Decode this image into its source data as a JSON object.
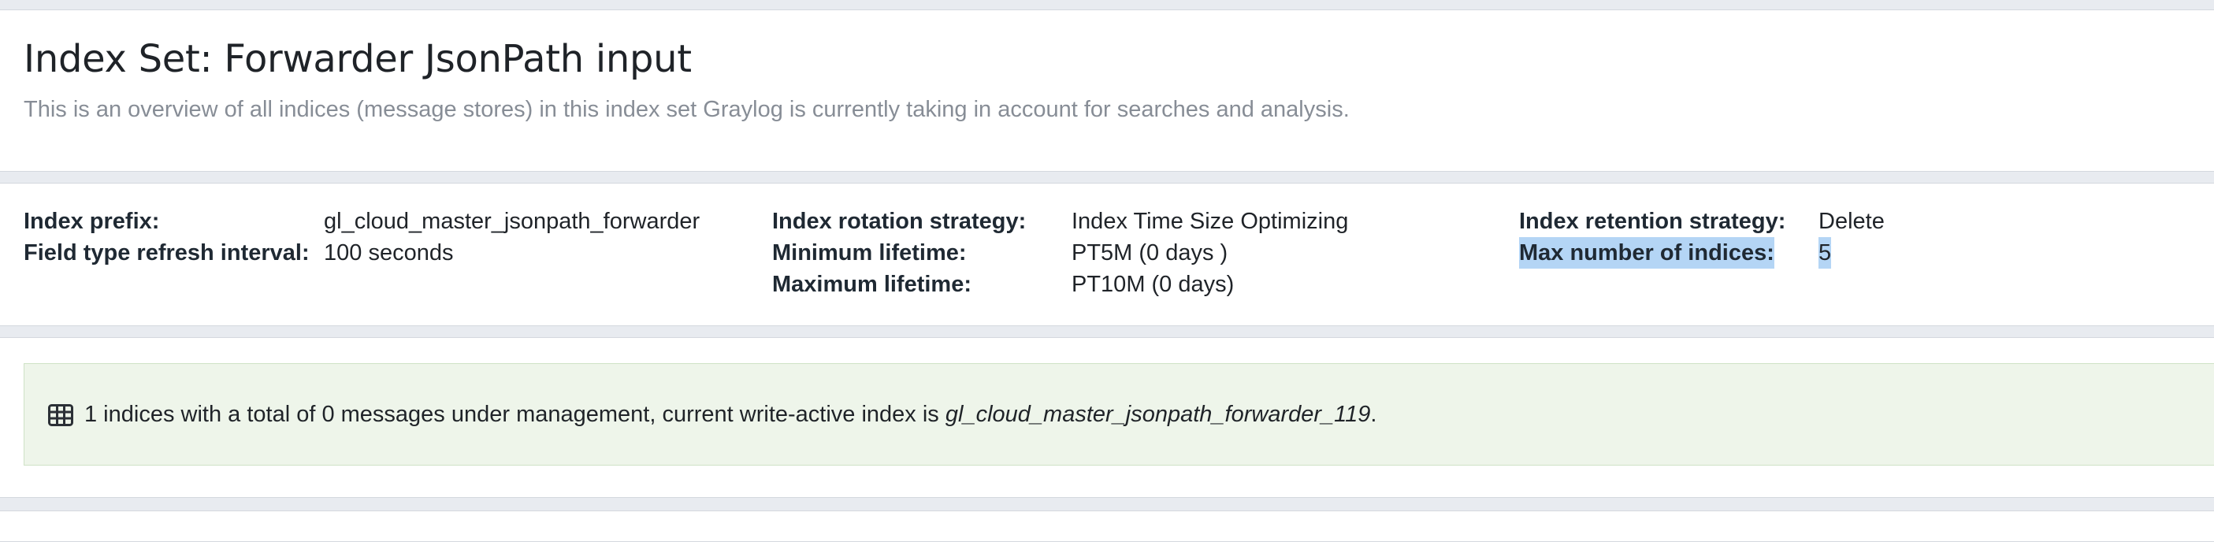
{
  "header": {
    "title": "Index Set: Forwarder JsonPath input",
    "description": "This is an overview of all indices (message stores) in this index set Graylog is currently taking in account for searches and analysis."
  },
  "config": {
    "index_prefix": {
      "label": "Index prefix:",
      "value": "gl_cloud_master_jsonpath_forwarder"
    },
    "field_type_refresh": {
      "label": "Field type refresh interval:",
      "value": "100 seconds"
    },
    "rotation_strategy": {
      "label": "Index rotation strategy:",
      "value": "Index Time Size Optimizing"
    },
    "min_lifetime": {
      "label": "Minimum lifetime:",
      "value": "PT5M (0 days )"
    },
    "max_lifetime": {
      "label": "Maximum lifetime:",
      "value": "PT10M (0 days)"
    },
    "retention_strategy": {
      "label": "Index retention strategy:",
      "value": "Delete"
    },
    "max_indices": {
      "label": "Max number of indices:",
      "value": "5"
    }
  },
  "summary": {
    "icon": "table-icon",
    "text_prefix": "1 indices with a total of 0 messages under management, current write-active index is ",
    "active_index": "gl_cloud_master_jsonpath_forwarder_119",
    "text_suffix": "."
  },
  "colors": {
    "background": "#e8ebf0",
    "panel": "#ffffff",
    "alert_background": "#eef5ea",
    "alert_border": "#cfe2c6",
    "muted_text": "#878d96",
    "selection_highlight": "#b4d5f5"
  }
}
